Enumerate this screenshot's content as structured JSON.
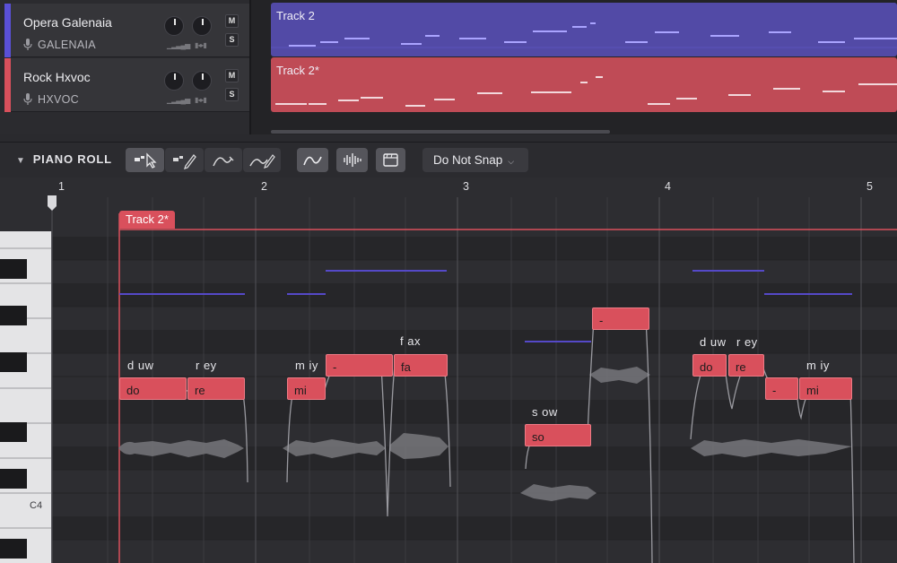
{
  "tracks": [
    {
      "name": "Opera Galenaia",
      "voice": "GALENAIA",
      "color": "#5a50d6",
      "mute": "M",
      "solo": "S"
    },
    {
      "name": "Rock Hxvoc",
      "voice": "HXVOC",
      "color": "#d9505c",
      "mute": "M",
      "solo": "S"
    }
  ],
  "clips": [
    {
      "title": "Track 2",
      "color": "#524aa6"
    },
    {
      "title": "Track 2*",
      "color": "#bf4b56"
    }
  ],
  "piano_roll": {
    "title": "PIANO ROLL",
    "snap_label": "Do Not Snap",
    "bars": [
      "1",
      "2",
      "3",
      "4",
      "5"
    ],
    "clip_label": "Track 2*",
    "key_label": "C4"
  },
  "notes": [
    {
      "lyric": "do",
      "phoneme": "d uw"
    },
    {
      "lyric": "re",
      "phoneme": "r ey"
    },
    {
      "lyric": "mi",
      "phoneme": "m iy"
    },
    {
      "lyric": "-",
      "phoneme": ""
    },
    {
      "lyric": "fa",
      "phoneme": "f ax"
    },
    {
      "lyric": "so",
      "phoneme": "s ow"
    },
    {
      "lyric": "-",
      "phoneme": ""
    },
    {
      "lyric": "do",
      "phoneme": "d uw"
    },
    {
      "lyric": "re",
      "phoneme": "r ey"
    },
    {
      "lyric": "-",
      "phoneme": ""
    },
    {
      "lyric": "mi",
      "phoneme": "m iy"
    }
  ],
  "icons": [
    "mic-icon",
    "select-tool-icon",
    "draw-tool-icon",
    "vibrato-tool-icon",
    "pitch-draw-tool-icon",
    "pitch-curve-icon",
    "waveform-icon",
    "video-icon",
    "collapse-chevron-icon",
    "snap-caret-icon"
  ]
}
